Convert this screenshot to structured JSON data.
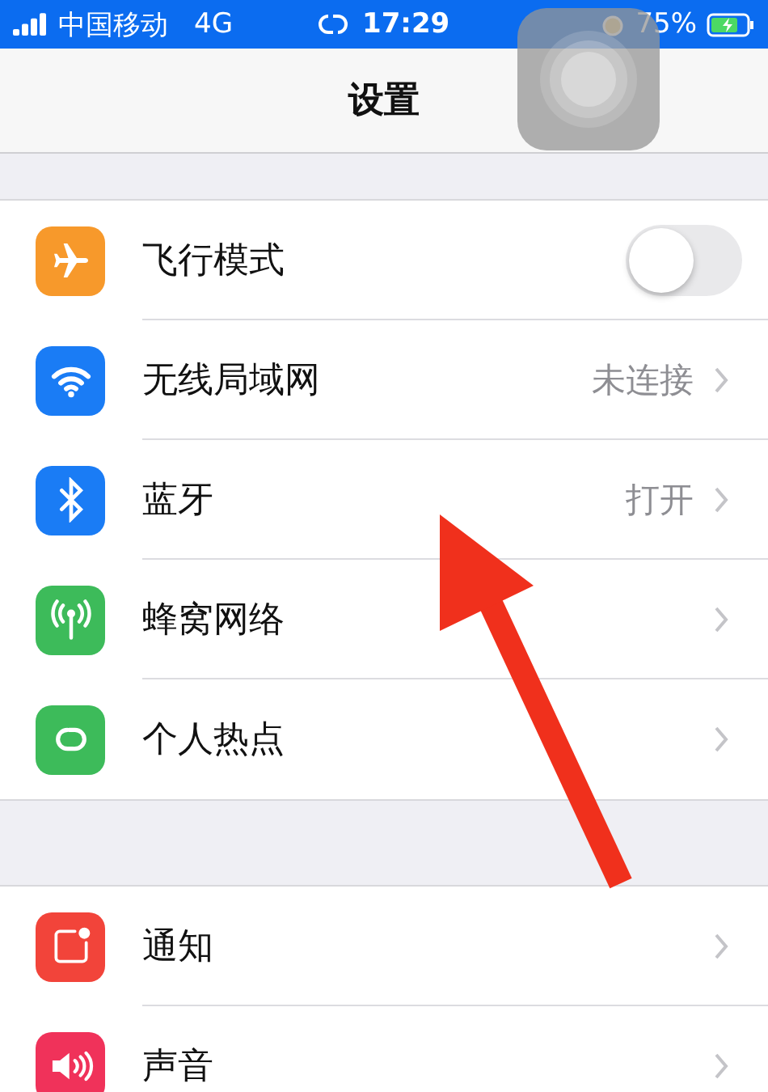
{
  "status_bar": {
    "carrier": "中国移动",
    "network": "4G",
    "time": "17:29",
    "battery": "75%"
  },
  "nav": {
    "title": "设置"
  },
  "groups": [
    {
      "rows": [
        {
          "kind": "toggle",
          "label": "飞行模式",
          "color": "#f7992b",
          "on": false
        },
        {
          "kind": "detail",
          "label": "无线局域网",
          "color": "#1a7cf5",
          "value": "未连接"
        },
        {
          "kind": "detail",
          "label": "蓝牙",
          "color": "#1a7cf5",
          "value": "打开"
        },
        {
          "kind": "detail",
          "label": "蜂窝网络",
          "color": "#3dbb5a"
        },
        {
          "kind": "detail",
          "label": "个人热点",
          "color": "#3dbb5a"
        }
      ]
    },
    {
      "rows": [
        {
          "kind": "detail",
          "label": "通知",
          "color": "#f2443a"
        },
        {
          "kind": "detail",
          "label": "声音",
          "color": "#f0325a"
        }
      ]
    }
  ]
}
